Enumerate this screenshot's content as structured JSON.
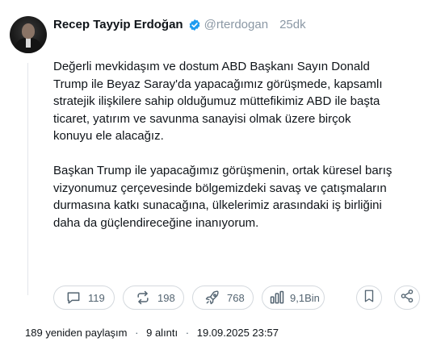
{
  "tweet": {
    "author_name": "Recep Tayyip Erdoğan",
    "handle": "@rterdogan",
    "time": "25dk",
    "verified_color": "#1d9bf0",
    "paragraphs": [
      "Değerli mevkidaşım ve dostum ABD Başkanı Sayın Donald Trump ile Beyaz Saray'da yapacağımız görüşmede, kapsamlı stratejik ilişkilere sahip olduğumuz müttefikimiz ABD ile başta ticaret, yatırım ve savunma sanayisi olmak üzere birçok konuyu ele alacağız.",
      "Başkan Trump ile yapacağımız görüşmenin, ortak küresel barış vizyonumuz çerçevesinde bölgemizdeki savaş ve çatışmaların durmasına katkı sunacağına, ülkelerimiz arasındaki iş birliğini daha da güçlendireceğine inanıyorum."
    ]
  },
  "actions": {
    "reply": {
      "icon": "reply-icon",
      "count": "119"
    },
    "repost": {
      "icon": "repost-icon",
      "count": "198"
    },
    "like": {
      "icon": "rocket-icon",
      "count": "768"
    },
    "views": {
      "icon": "views-icon",
      "count": "9,1Bin"
    },
    "bookmark": {
      "icon": "bookmark-icon"
    },
    "share": {
      "icon": "share-icon"
    }
  },
  "footer": {
    "reposts": "189",
    "reposts_label": "yeniden paylaşım",
    "quotes": "9",
    "quotes_label": "alıntı",
    "datetime": "19.09.2025 23:57"
  }
}
